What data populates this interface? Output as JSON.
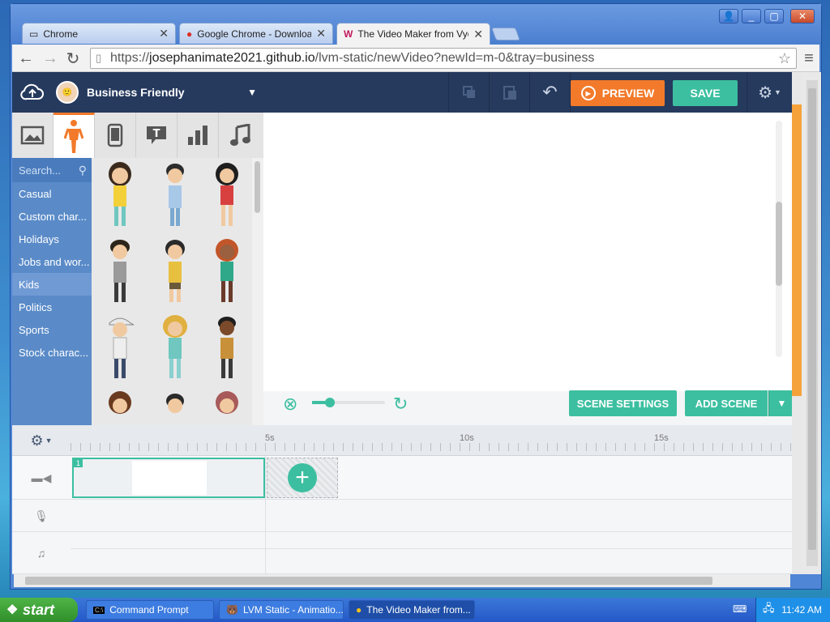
{
  "browser": {
    "tabs": [
      {
        "title": "Chrome"
      },
      {
        "title": "Google Chrome - Download t"
      },
      {
        "title": "The Video Maker from Vyond"
      }
    ],
    "url_prefix": "https://",
    "url_domain": "josephanimate2021.github.io",
    "url_path": "/lvm-static/newVideo?newId=m-0&tray=business"
  },
  "app": {
    "theme_name": "Business Friendly",
    "preview_label": "PREVIEW",
    "save_label": "SAVE",
    "search_placeholder": "Search...",
    "categories": [
      {
        "label": "Casual",
        "selected": false
      },
      {
        "label": "Custom char...",
        "selected": false
      },
      {
        "label": "Holidays",
        "selected": false
      },
      {
        "label": "Jobs and wor...",
        "selected": false
      },
      {
        "label": "Kids",
        "selected": true
      },
      {
        "label": "Politics",
        "selected": false
      },
      {
        "label": "Sports",
        "selected": false
      },
      {
        "label": "Stock charac...",
        "selected": false
      }
    ],
    "asset_tabs": [
      "image-icon",
      "character-icon",
      "phone-prop-icon",
      "speech-bubble-icon",
      "chart-icon",
      "music-icon"
    ],
    "scene_settings_label": "SCENE SETTINGS",
    "add_scene_label": "ADD SCENE",
    "timeline": {
      "ticks": [
        "5s",
        "10s",
        "15s"
      ],
      "scene_number": "1"
    },
    "colors": {
      "accent_orange": "#f27a2a",
      "accent_teal": "#3cbfa0",
      "topbar": "#263a5e",
      "nav_blue": "#5a8bc8"
    }
  },
  "taskbar": {
    "start_label": "start",
    "tasks": [
      {
        "label": "Command Prompt",
        "active": false
      },
      {
        "label": "LVM Static - Animatio...",
        "active": false
      },
      {
        "label": "The Video Maker from...",
        "active": true
      }
    ],
    "clock": "11:42 AM"
  }
}
